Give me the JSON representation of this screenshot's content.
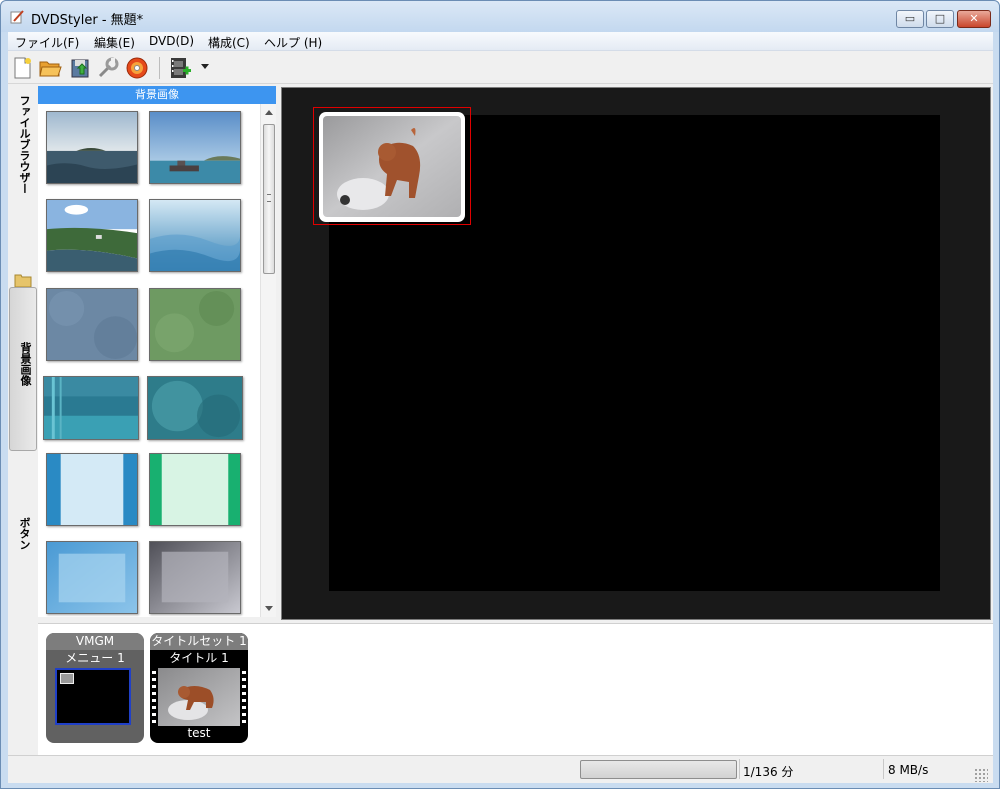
{
  "window": {
    "title": "DVDStyler - 無題*",
    "min_label": "▭",
    "max_label": "□",
    "close_label": "✕"
  },
  "menubar": {
    "items": [
      {
        "label": "ファイル(F)"
      },
      {
        "label": "編集(E)"
      },
      {
        "label": "DVD(D)"
      },
      {
        "label": "構成(C)"
      },
      {
        "label": "ヘルプ (H)"
      }
    ]
  },
  "toolbar": {
    "icons": [
      "new-document-icon",
      "open-folder-icon",
      "save-icon",
      "settings-wrench-icon",
      "burn-disc-icon",
      "add-video-icon",
      "dropdown-arrow-icon"
    ]
  },
  "sidebar": {
    "tabs": [
      {
        "label": "ファイルブラウザー"
      },
      {
        "label": "背景画像"
      },
      {
        "label": "ボタン"
      }
    ]
  },
  "background_panel": {
    "header": "背景画像",
    "thumbnails": [
      "sea-island",
      "ship-harbor",
      "coast-aerial",
      "blue-waves",
      "blue-gray-texture",
      "green-texture",
      "teal-stripes",
      "teal-grunge",
      "blue-frame-light",
      "green-frame-light",
      "blue-gradient-frame",
      "gray-gradient-frame"
    ]
  },
  "canvas": {
    "button_label": "dog-photo-button"
  },
  "titleset_manager": {
    "vmgm": {
      "header": "VMGM",
      "item": "メニュー 1"
    },
    "titleset": {
      "header": "タイトルセット 1",
      "item": "タイトル 1",
      "caption": "test"
    }
  },
  "status": {
    "progress_fraction": 0.0,
    "time": "1/136 分",
    "rate": "8 MB/s"
  },
  "colors": {
    "panel_header": "#3d95f0",
    "selection": "#e00000",
    "menu_border": "#2040c8"
  }
}
